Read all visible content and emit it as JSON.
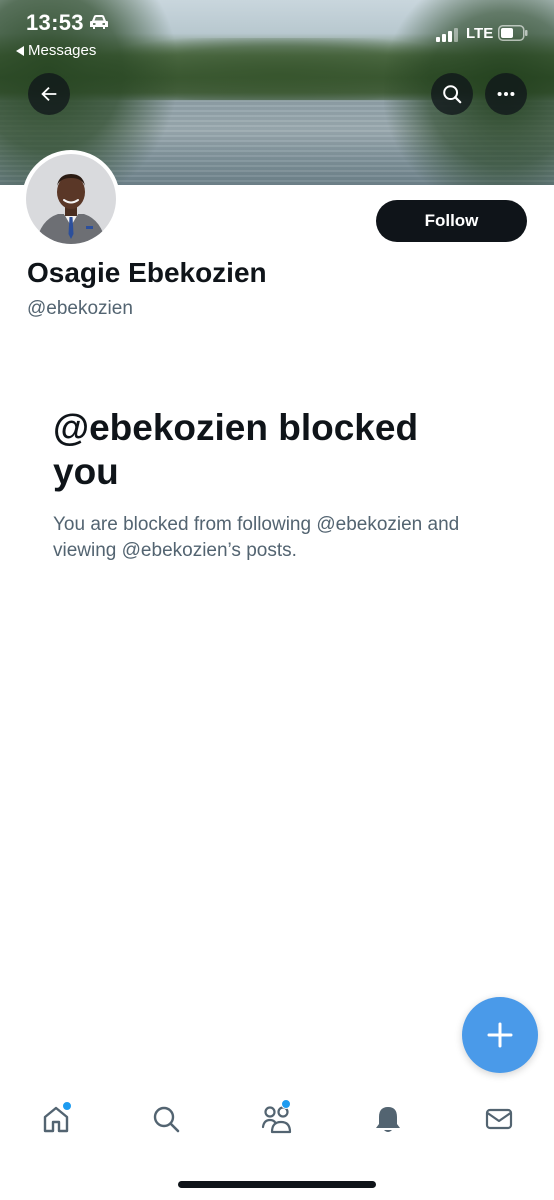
{
  "status_bar": {
    "time": "13:53",
    "back_app_label": "Messages",
    "network": "LTE"
  },
  "profile": {
    "display_name": "Osagie Ebekozien",
    "handle": "@ebekozien",
    "follow_label": "Follow"
  },
  "blocked": {
    "title": "@ebekozien blocked you",
    "description": "You are blocked from following @ebekozien and viewing @ebekozien’s posts."
  },
  "icons": {
    "back": "back-arrow-icon",
    "search": "search-icon",
    "more": "more-icon",
    "compose": "plus-icon",
    "tabs": [
      "home-icon",
      "search-icon",
      "communities-icon",
      "bell-icon",
      "mail-icon"
    ]
  },
  "colors": {
    "accent": "#1d9bf0",
    "fab": "#4a9ae9",
    "text_primary": "#0f1419",
    "text_secondary": "#536471"
  }
}
